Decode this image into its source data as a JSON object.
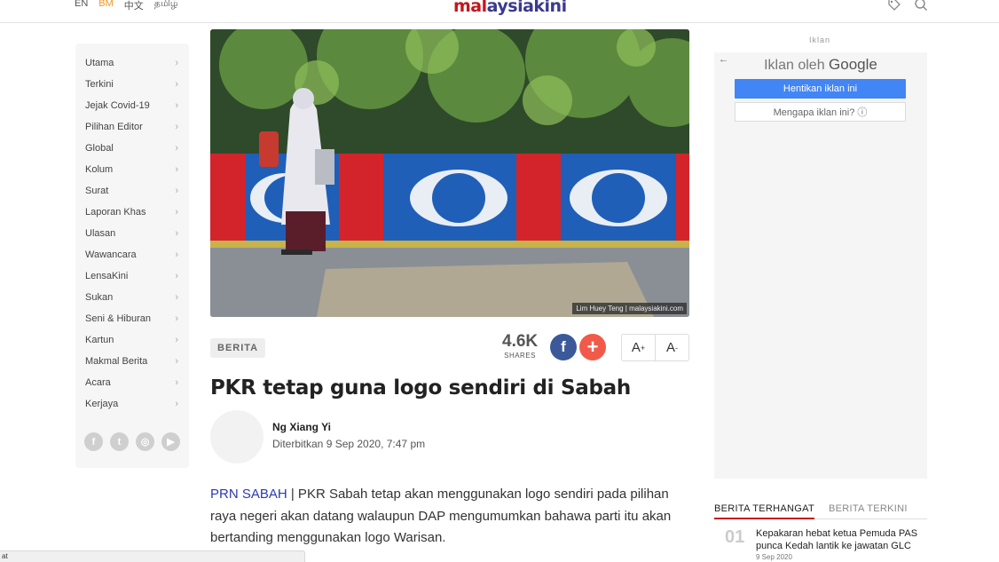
{
  "header": {
    "languages": [
      {
        "label": "EN",
        "active": false
      },
      {
        "label": "BM",
        "active": true
      },
      {
        "label": "中文",
        "active": false
      },
      {
        "label": "தமிழ்",
        "active": false
      }
    ],
    "logo_part1": "mal",
    "logo_part2": "aysiakini",
    "icons": [
      "tag-icon",
      "search-icon"
    ]
  },
  "sidebar": {
    "items": [
      {
        "label": "Utama"
      },
      {
        "label": "Terkini"
      },
      {
        "label": "Jejak Covid-19"
      },
      {
        "label": "Pilihan Editor"
      },
      {
        "label": "Global"
      },
      {
        "label": "Kolum"
      },
      {
        "label": "Surat"
      },
      {
        "label": "Laporan Khas"
      },
      {
        "label": "Ulasan"
      },
      {
        "label": "Wawancara"
      },
      {
        "label": "LensaKini"
      },
      {
        "label": "Sukan"
      },
      {
        "label": "Seni & Hiburan"
      },
      {
        "label": "Kartun"
      },
      {
        "label": "Makmal Berita"
      },
      {
        "label": "Acara"
      },
      {
        "label": "Kerjaya"
      }
    ],
    "chevron": "›",
    "socials": [
      {
        "icon": "facebook-icon",
        "glyph": "f"
      },
      {
        "icon": "twitter-icon",
        "glyph": "t"
      },
      {
        "icon": "instagram-icon",
        "glyph": "◎"
      },
      {
        "icon": "youtube-icon",
        "glyph": "▶"
      }
    ]
  },
  "article": {
    "photo_credit": "Lim Huey Teng | malaysiakini.com",
    "category": "BERITA",
    "shares_count": "4.6K",
    "shares_label": "SHARES",
    "facebook_glyph": "f",
    "plus_glyph": "+",
    "font_increase": "A",
    "font_decrease": "A",
    "font_increase_sup": "+",
    "font_decrease_sup": "-",
    "title": "PKR tetap guna logo sendiri di Sabah",
    "author": "Ng Xiang Yi",
    "published": "Diterbitkan 9 Sep 2020, 7:47 pm",
    "kicker": "PRN SABAH",
    "body": " | PKR Sabah tetap akan menggunakan logo sendiri pada pilihan raya negeri akan datang walaupun DAP mengumumkan bahawa parti itu akan bertanding menggunakan logo Warisan."
  },
  "ad": {
    "label": "Iklan",
    "back_glyph": "←",
    "title_prefix": "Iklan oleh ",
    "title_brand": "Google",
    "stop_button": "Hentikan iklan ini",
    "why_button": "Mengapa iklan ini? ⓘ"
  },
  "news": {
    "tabs": [
      {
        "label": "BERITA TERHANGAT",
        "active": true
      },
      {
        "label": "BERITA TERKINI",
        "active": false
      }
    ],
    "items": [
      {
        "num": "01",
        "title": "Kepakaran hebat ketua Pemuda PAS punca Kedah lantik ke jawatan GLC",
        "date": "9 Sep 2020"
      }
    ]
  },
  "statusbar": {
    "text": "at"
  },
  "colors": {
    "brand_red": "#c4161c",
    "brand_blue": "#3a3a8f",
    "lang_active": "#f7941d",
    "facebook": "#3b5998",
    "plus": "#f15a4a",
    "google_blue": "#4285f4"
  }
}
